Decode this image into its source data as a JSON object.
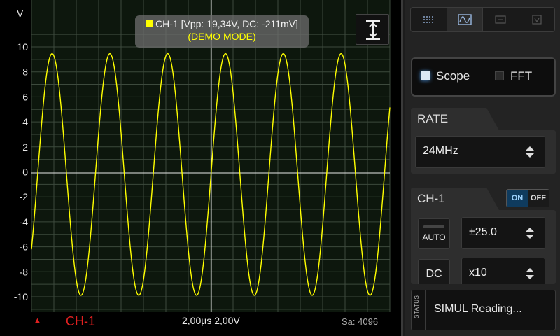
{
  "plot": {
    "y_unit": "V",
    "y_ticks": [
      "10",
      "8",
      "6",
      "4",
      "2",
      "0",
      "-2",
      "-4",
      "-6",
      "-8",
      "-10"
    ],
    "info_line1": "CH-1 [Vpp: 19,34V, DC: -211mV]",
    "info_line2": "(DEMO MODE)",
    "trace_color": "#ffff00",
    "grid_color": "#3d4a3d",
    "vscale_icon": "vertical-expand-icon"
  },
  "bottom": {
    "trigger_icon": "▲",
    "channel": "CH-1",
    "timebase": "2,00µs  2,00V",
    "samples": "Sa: 4096"
  },
  "panel": {
    "toolbar_icons": [
      "grid-icon",
      "scope-icon",
      "board-icon",
      "info-icon"
    ],
    "mode": {
      "scope": "Scope",
      "fft": "FFT",
      "selected": "Scope"
    },
    "rate": {
      "title": "RATE",
      "value": "24MHz"
    },
    "ch1": {
      "title": "CH-1",
      "on_label": "ON",
      "off_label": "OFF",
      "auto_label": "AUTO",
      "range_value": "±25.0",
      "coupling_label": "DC",
      "probe_value": "x10"
    },
    "status": {
      "tab_label": "STATUS",
      "text": "SIMUL Reading..."
    }
  },
  "chart_data": {
    "type": "line",
    "title": "",
    "xlabel": "",
    "ylabel": "V",
    "ylim": [
      -10,
      10
    ],
    "series": [
      {
        "name": "CH-1",
        "waveform": "sine",
        "amplitude": 9.67,
        "offset": -0.211,
        "cycles_visible": 6.2,
        "start_value": -6.2,
        "color": "#ffff00"
      }
    ]
  }
}
